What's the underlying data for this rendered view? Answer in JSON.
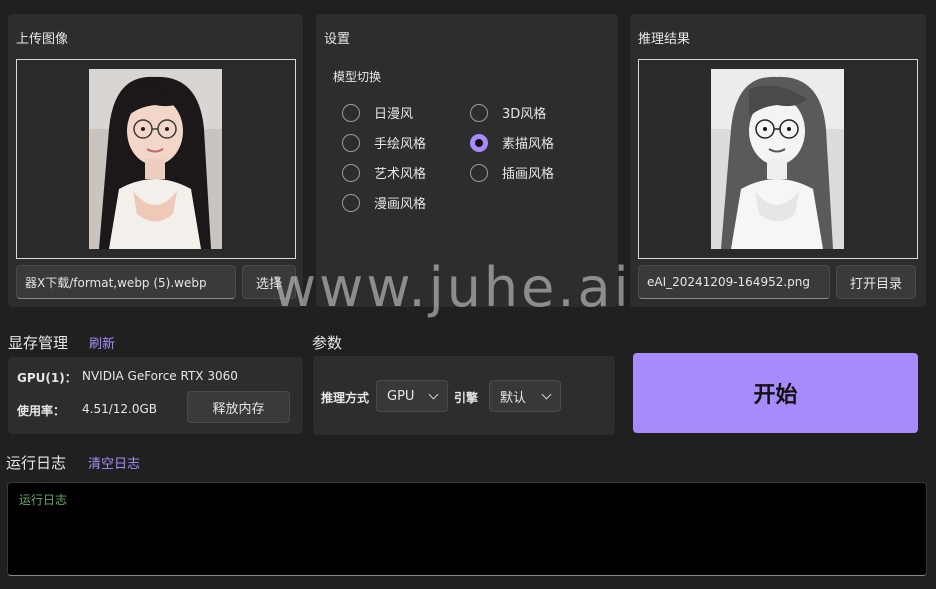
{
  "upload": {
    "title": "上传图像",
    "filename": "器X下载/format,webp (5).webp",
    "select_label": "选择"
  },
  "settings": {
    "title": "设置",
    "model_switch_label": "模型切换",
    "styles": [
      {
        "label": "日漫风",
        "selected": false
      },
      {
        "label": "3D风格",
        "selected": false
      },
      {
        "label": "手绘风格",
        "selected": false
      },
      {
        "label": "素描风格",
        "selected": true
      },
      {
        "label": "艺术风格",
        "selected": false
      },
      {
        "label": "插画风格",
        "selected": false
      },
      {
        "label": "漫画风格",
        "selected": false
      }
    ]
  },
  "result": {
    "title": "推理结果",
    "filename": "eAI_20241209-164952.png",
    "open_dir_label": "打开目录"
  },
  "vram": {
    "title": "显存管理",
    "refresh_label": "刷新",
    "gpu_label": "GPU(1)：",
    "gpu_name": "NVIDIA GeForce RTX 3060",
    "usage_label": "使用率：",
    "usage_value": "4.51/12.0GB",
    "release_label": "释放内存"
  },
  "params": {
    "title": "参数",
    "method_label": "推理方式",
    "method_value": "GPU",
    "engine_label": "引擎",
    "engine_value": "默认"
  },
  "start_label": "开始",
  "log": {
    "title": "运行日志",
    "clear_label": "清空日志",
    "placeholder": "运行日志"
  },
  "watermark": "www.juhe.ai",
  "colors": {
    "accent": "#a78bfa",
    "background": "#202020",
    "panel": "#2d2d2d"
  }
}
